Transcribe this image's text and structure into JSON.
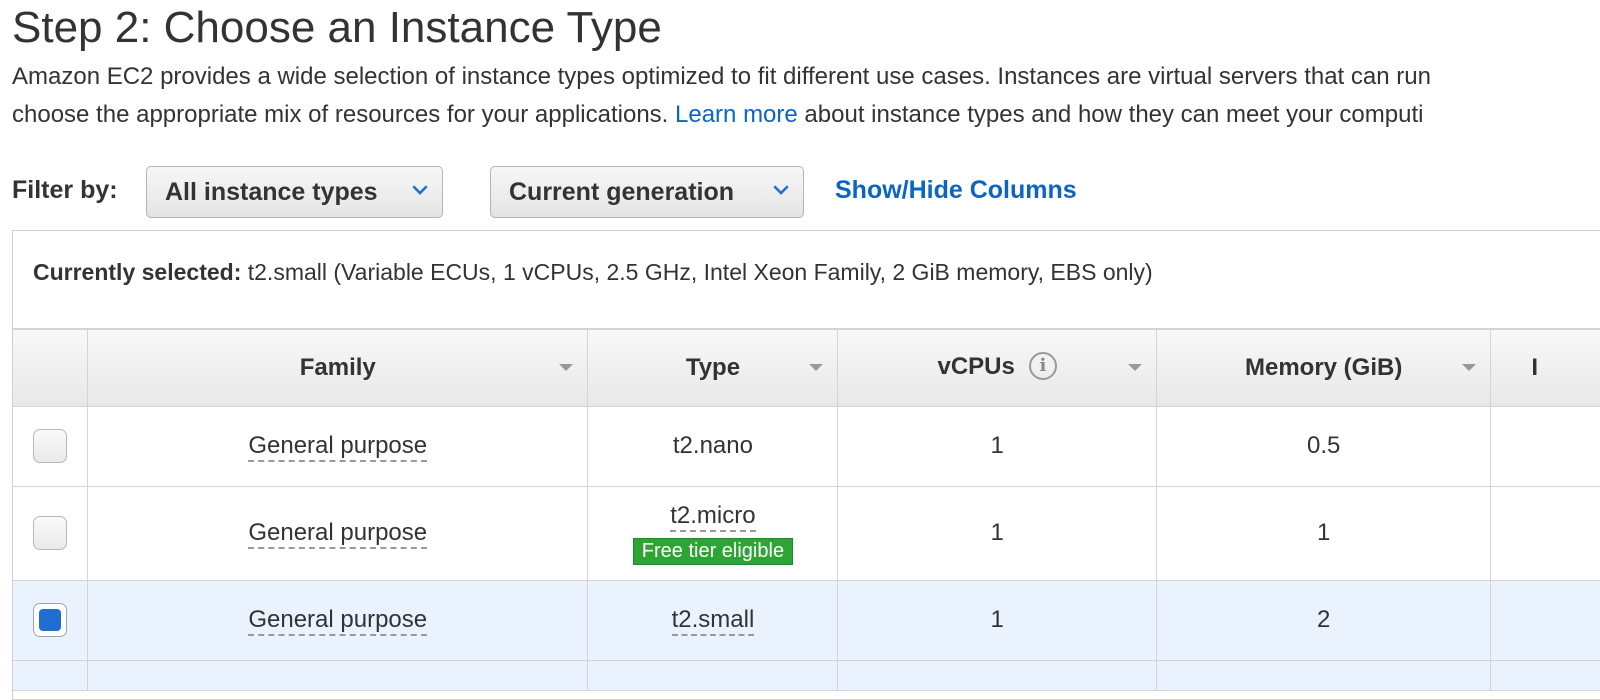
{
  "header": {
    "title": "Step 2: Choose an Instance Type",
    "desc_line1": "Amazon EC2 provides a wide selection of instance types optimized to fit different use cases. Instances are virtual servers that can run",
    "desc_line2_prefix": "choose the appropriate mix of resources for your applications.",
    "learn_more": "Learn more",
    "desc_line2_suffix": "about instance types and how they can meet your computi"
  },
  "filters": {
    "label": "Filter by:",
    "instance_types": "All instance types",
    "generation": "Current generation",
    "show_hide": "Show/Hide Columns"
  },
  "selection": {
    "label": "Currently selected:",
    "value": "t2.small (Variable ECUs, 1 vCPUs, 2.5 GHz, Intel Xeon Family, 2 GiB memory, EBS only)"
  },
  "table": {
    "columns": [
      "Family",
      "Type",
      "vCPUs",
      "Memory (GiB)",
      "I"
    ],
    "rows": [
      {
        "family": "General purpose",
        "type": "t2.nano",
        "vcpus": "1",
        "memory": "0.5",
        "selected": false,
        "badge": ""
      },
      {
        "family": "General purpose",
        "type": "t2.micro",
        "vcpus": "1",
        "memory": "1",
        "selected": false,
        "badge": "Free tier eligible"
      },
      {
        "family": "General purpose",
        "type": "t2.small",
        "vcpus": "1",
        "memory": "2",
        "selected": true,
        "badge": ""
      }
    ]
  },
  "icons": {
    "chevron": "chevron-down-icon",
    "sort": "sort-caret-icon",
    "info": "info-icon"
  },
  "colors": {
    "link": "#0b66c2",
    "selected_row": "#eaf3fd",
    "checkbox_checked": "#1f6fd0",
    "badge": "#2ea434"
  }
}
